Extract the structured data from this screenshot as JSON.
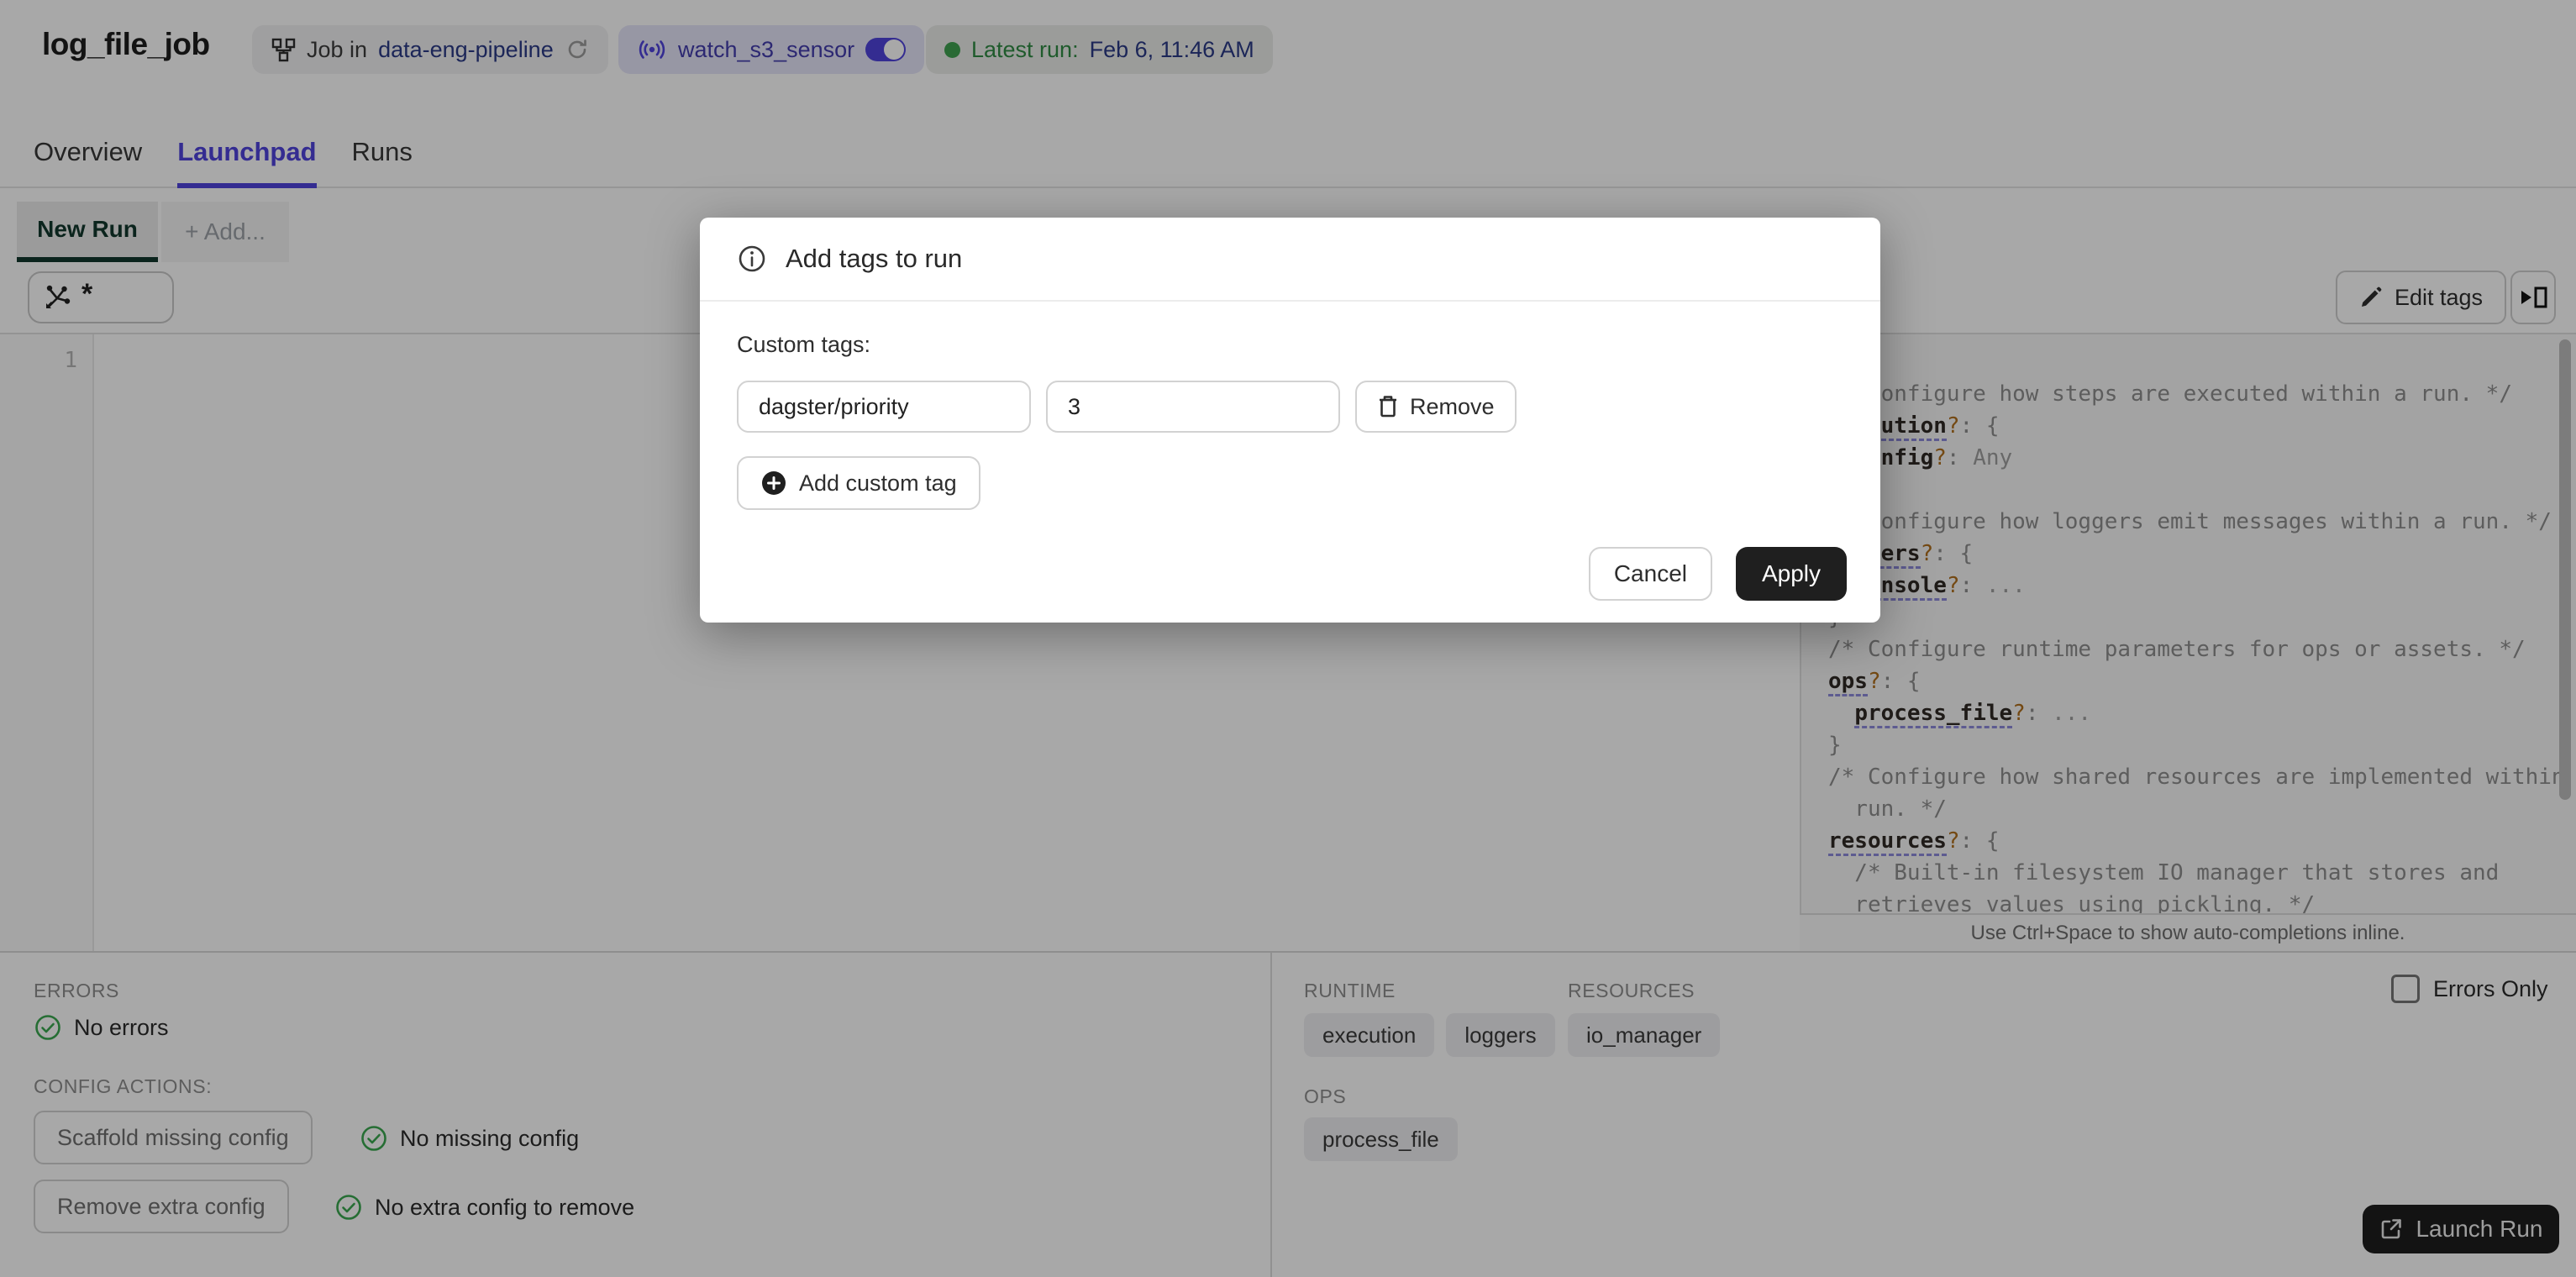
{
  "header": {
    "title": "log_file_job",
    "job_chip": {
      "prefix": "Job in",
      "link": "data-eng-pipeline"
    },
    "sensor_chip": {
      "label": "watch_s3_sensor"
    },
    "latest_run_chip": {
      "prefix": "Latest run:",
      "value": "Feb 6, 11:46 AM"
    }
  },
  "tabs": [
    {
      "label": "Overview",
      "active": false
    },
    {
      "label": "Launchpad",
      "active": true
    },
    {
      "label": "Runs",
      "active": false
    }
  ],
  "launchpad": {
    "new_run_tab": "New Run",
    "add_tab": "+ Add...",
    "op_selector_value": "*",
    "edit_tags_button": "Edit tags",
    "editor_line_number": "1",
    "hint_bar": "Use Ctrl+Space to show auto-completions inline."
  },
  "modal": {
    "title": "Add tags to run",
    "custom_tags_label": "Custom tags:",
    "tag_key_value": "dagster/priority",
    "tag_value_value": "3",
    "remove_button": "Remove",
    "add_custom_tag_button": "Add custom tag",
    "cancel_button": "Cancel",
    "apply_button": "Apply"
  },
  "schema_panel": {
    "lines": [
      [
        {
          "t": "{",
          "c": "p"
        }
      ],
      [
        {
          "t": "/* Configure how steps are executed within a run. */",
          "c": "cm"
        }
      ],
      [
        {
          "t": "execution",
          "c": "k"
        },
        {
          "t": "?",
          "c": "q"
        },
        {
          "t": ": {",
          "c": "p"
        }
      ],
      [
        {
          "t": "  ",
          "c": "p"
        },
        {
          "t": "config",
          "c": "k2"
        },
        {
          "t": "?",
          "c": "q"
        },
        {
          "t": ": ",
          "c": "p"
        },
        {
          "t": "Any",
          "c": "v"
        }
      ],
      [
        {
          "t": "}",
          "c": "p"
        }
      ],
      [
        {
          "t": "/* Configure how loggers emit messages within a run. */",
          "c": "cm"
        }
      ],
      [
        {
          "t": "loggers",
          "c": "k"
        },
        {
          "t": "?",
          "c": "q"
        },
        {
          "t": ": {",
          "c": "p"
        }
      ],
      [
        {
          "t": "  ",
          "c": "p"
        },
        {
          "t": "console",
          "c": "k"
        },
        {
          "t": "?",
          "c": "q"
        },
        {
          "t": ": ",
          "c": "p"
        },
        {
          "t": "...",
          "c": "v"
        }
      ],
      [
        {
          "t": "}",
          "c": "p"
        }
      ],
      [
        {
          "t": "/* Configure runtime parameters for ops or assets. */",
          "c": "cm"
        }
      ],
      [
        {
          "t": "ops",
          "c": "k"
        },
        {
          "t": "?",
          "c": "q"
        },
        {
          "t": ": {",
          "c": "p"
        }
      ],
      [
        {
          "t": "  ",
          "c": "p"
        },
        {
          "t": "process_file",
          "c": "k"
        },
        {
          "t": "?",
          "c": "q"
        },
        {
          "t": ": ",
          "c": "p"
        },
        {
          "t": "...",
          "c": "v"
        }
      ],
      [
        {
          "t": "}",
          "c": "p"
        }
      ],
      [
        {
          "t": "/* Configure how shared resources are implemented within a",
          "c": "cm"
        }
      ],
      [
        {
          "t": "  run. */",
          "c": "cm"
        }
      ],
      [
        {
          "t": "resources",
          "c": "k"
        },
        {
          "t": "?",
          "c": "q"
        },
        {
          "t": ": {",
          "c": "p"
        }
      ],
      [
        {
          "t": "  /* Built-in filesystem IO manager that stores and",
          "c": "cm"
        }
      ],
      [
        {
          "t": "  retrieves values using pickling. */",
          "c": "cm"
        }
      ]
    ]
  },
  "bottom_left": {
    "errors_label": "ERRORS",
    "no_errors": "No errors",
    "config_actions_label": "CONFIG ACTIONS:",
    "scaffold_button": "Scaffold missing config",
    "no_missing_config": "No missing config",
    "remove_extra_button": "Remove extra config",
    "no_extra_config": "No extra config to remove"
  },
  "bottom_right": {
    "runtime_label": "RUNTIME",
    "resources_label": "RESOURCES",
    "ops_label": "OPS",
    "runtime_tags": [
      "execution",
      "loggers"
    ],
    "resource_tags": [
      "io_manager"
    ],
    "op_tags": [
      "process_file"
    ],
    "errors_only_label": "Errors Only",
    "launch_run_button": "Launch Run"
  },
  "colors": {
    "accent_blurple": "#4F43DD",
    "success_green": "#3BA74F",
    "active_tab_green": "#12382C",
    "dark_button": "#1F1F1F",
    "link_navy": "#2B3A86"
  }
}
